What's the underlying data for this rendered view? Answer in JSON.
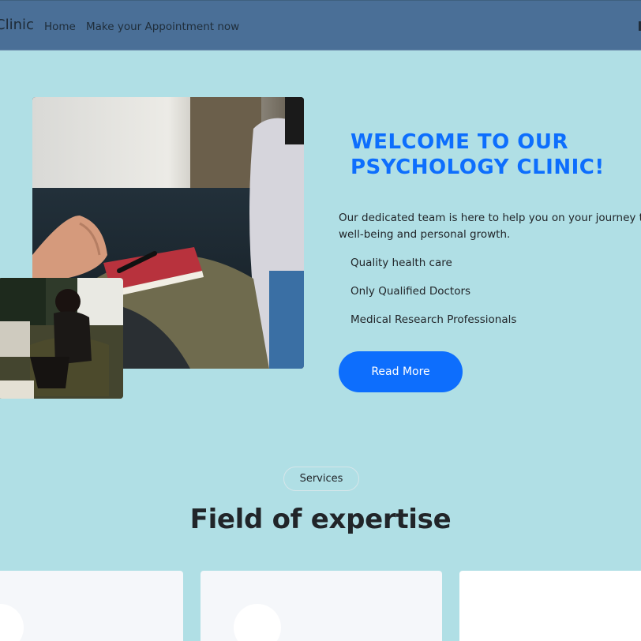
{
  "navbar": {
    "brand": "Clinic",
    "links": [
      "Home",
      "Make your Appointment now"
    ]
  },
  "hero": {
    "title_line1": "WELCOME TO OUR",
    "title_line2": "PSYCHOLOGY CLINIC!",
    "description_line1": "Our dedicated team is here to help you on your journey towa",
    "description_line2": "well-being and personal growth.",
    "features": [
      "Quality health care",
      "Only Qualified Doctors",
      "Medical Research Professionals"
    ],
    "button_label": "Read More"
  },
  "services": {
    "pill": "Services",
    "title": "Field of expertise"
  },
  "colors": {
    "background": "#b0dfe5",
    "navbar": "#4a6f97",
    "accent": "#0d6efd"
  }
}
